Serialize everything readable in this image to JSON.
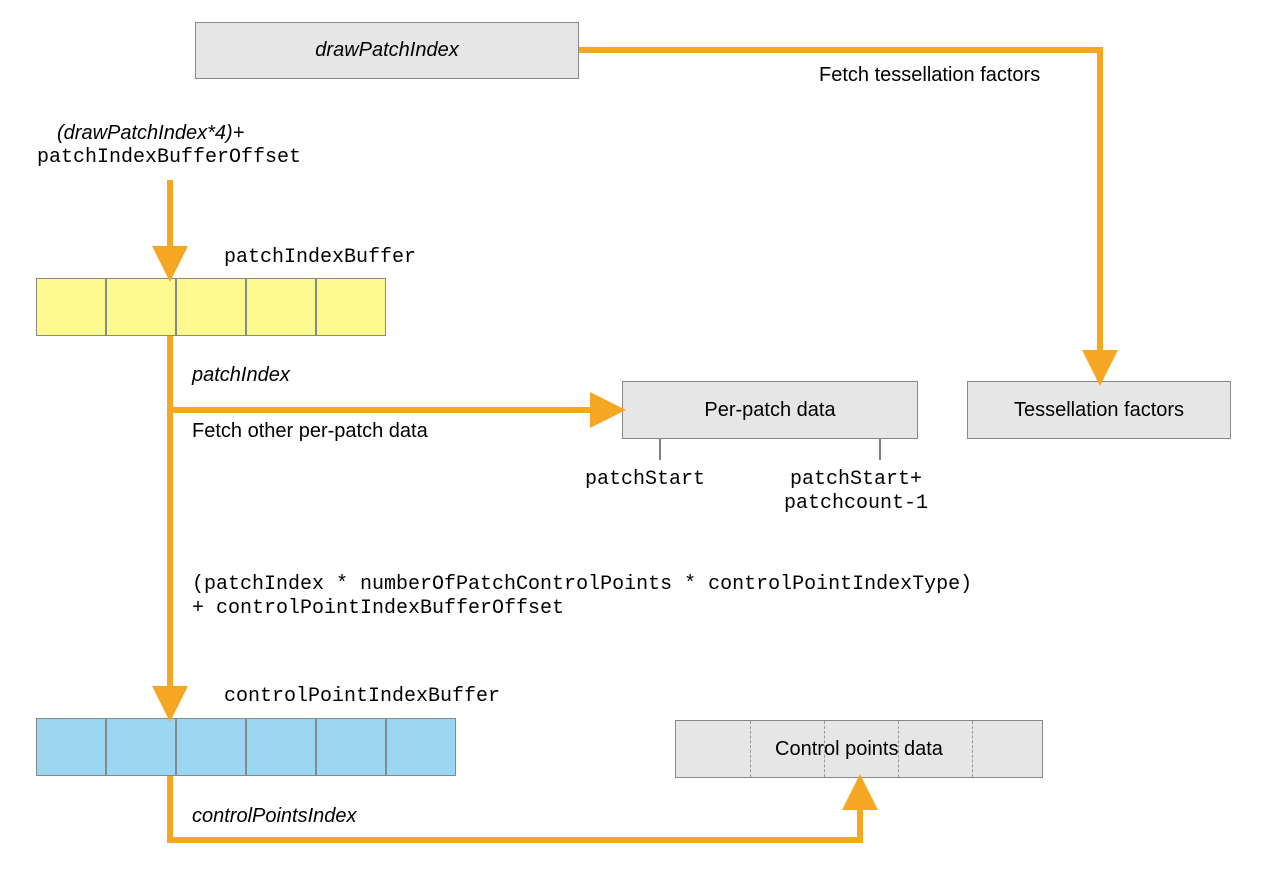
{
  "drawPatchIndex": "drawPatchIndex",
  "fetchTessLabel": "Fetch tessellation factors",
  "formula1_line1": "(drawPatchIndex*4)+",
  "formula1_line2": "patchIndexBufferOffset",
  "patchIndexBufferLabel": "patchIndexBuffer",
  "patchIndexLabel": "patchIndex",
  "fetchPerPatchLabel": "Fetch other per-patch data",
  "perPatchDataBox": "Per-patch data",
  "tessFactorsBox": "Tessellation factors",
  "patchStartLabel": "patchStart",
  "patchStartPlus1": "patchStart+",
  "patchStartPlus2": "patchcount-1",
  "formula2_line1": "(patchIndex * numberOfPatchControlPoints * controlPointIndexType)",
  "formula2_line2": "+ controlPointIndexBufferOffset",
  "cpIndexBufferLabel": "controlPointIndexBuffer",
  "cpIndexLabel": "controlPointsIndex",
  "controlPointsDataBox": "Control points data"
}
